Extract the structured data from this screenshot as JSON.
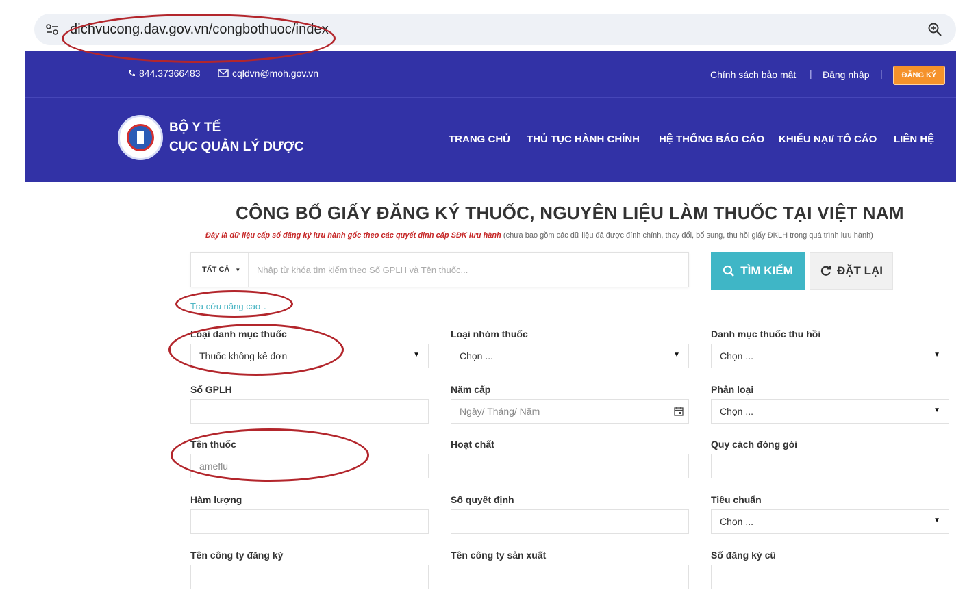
{
  "browser": {
    "url": "dichvucong.dav.gov.vn/congbothuoc/index"
  },
  "topbar": {
    "phone": "844.37366483",
    "email": "cqldvn@moh.gov.vn",
    "privacy_link": "Chính sách bảo mật",
    "login_link": "Đăng nhập",
    "register_button": "ĐĂNG KÝ",
    "separator": "|"
  },
  "header": {
    "org_line1": "BỘ Y TẾ",
    "org_line2": "CỤC QUẢN LÝ DƯỢC",
    "nav": [
      {
        "label": "TRANG CHỦ"
      },
      {
        "label": "THỦ TỤC HÀNH CHÍNH"
      },
      {
        "label": "HỆ THỐNG BÁO CÁO"
      },
      {
        "label": "KHIẾU NẠI/ TỐ CÁO"
      },
      {
        "label": "LIÊN HỆ"
      }
    ]
  },
  "main": {
    "title": "CÔNG BỐ GIẤY ĐĂNG KÝ THUỐC, NGUYÊN LIỆU LÀM THUỐC TẠI VIỆT NAM",
    "subtitle_red": "Đây là dữ liệu cấp số đăng ký lưu hành gốc theo các quyết định cấp SĐK lưu hành",
    "subtitle_grey": " (chưa bao gồm các dữ liệu đã được đính chính, thay đổi, bổ sung, thu hồi giấy ĐKLH trong quá trình lưu hành)"
  },
  "search": {
    "scope_label": "TẤT CẢ",
    "placeholder": "Nhập từ khóa tìm kiếm theo Số GPLH và Tên thuốc...",
    "search_button": "TÌM KIẾM",
    "reset_button": "ĐẶT LẠI",
    "advanced_link": "Tra cứu nâng cao"
  },
  "form": {
    "loai_danh_muc": {
      "label": "Loại danh mục thuốc",
      "value": "Thuốc không kê đơn"
    },
    "loai_nhom": {
      "label": "Loại nhóm thuốc",
      "value": "Chọn ..."
    },
    "danh_muc_thu_hoi": {
      "label": "Danh mục thuốc thu hồi",
      "value": "Chọn ..."
    },
    "so_gplh": {
      "label": "Số GPLH",
      "value": ""
    },
    "nam_cap": {
      "label": "Năm cấp",
      "placeholder": "Ngày/ Tháng/ Năm"
    },
    "phan_loai": {
      "label": "Phân loại",
      "value": "Chọn ..."
    },
    "ten_thuoc": {
      "label": "Tên thuốc",
      "value": "ameflu"
    },
    "hoat_chat": {
      "label": "Hoạt chất",
      "value": ""
    },
    "quy_cach": {
      "label": "Quy cách đóng gói",
      "value": ""
    },
    "ham_luong": {
      "label": "Hàm lượng",
      "value": ""
    },
    "so_quyet_dinh": {
      "label": "Số quyết định",
      "value": ""
    },
    "tieu_chuan": {
      "label": "Tiêu chuẩn",
      "value": "Chọn ..."
    },
    "cty_dang_ky": {
      "label": "Tên công ty đăng ký",
      "value": ""
    },
    "cty_san_xuat": {
      "label": "Tên công ty sản xuất",
      "value": ""
    },
    "so_dang_ky_cu": {
      "label": "Số đăng ký cũ",
      "value": ""
    }
  },
  "colors": {
    "header_blue": "#3232a6",
    "search_teal": "#3fb6c6",
    "register_orange": "#f5922b",
    "annotation_red": "#b3262c"
  }
}
